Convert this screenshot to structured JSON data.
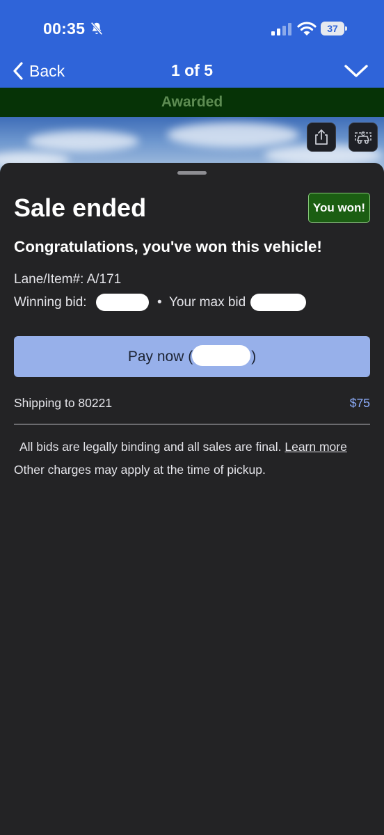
{
  "status_bar": {
    "time": "00:35",
    "battery": "37"
  },
  "navbar": {
    "back_label": "Back",
    "title": "1 of 5"
  },
  "banner": {
    "label": "Awarded"
  },
  "sheet": {
    "title": "Sale ended",
    "badge": "You won!",
    "congrats": "Congratulations, you've won this vehicle!",
    "lane_item": "Lane/Item#: A/171",
    "winning_bid_label": "Winning bid:",
    "separator": "•",
    "max_bid_label": "Your max bid",
    "pay_label_prefix": "Pay now (",
    "pay_label_suffix": ")",
    "shipping_label": "Shipping to 80221",
    "shipping_price": "$75",
    "legal_line1": "All bids are legally binding and all sales are final.",
    "learn_more": "Learn more",
    "legal_line2": "Other charges may apply at the time of pickup."
  },
  "icons": [
    "bell-slash-icon",
    "signal-icon",
    "wifi-icon",
    "battery-icon",
    "chevron-left-icon",
    "chevron-down-icon",
    "share-icon",
    "vehicle-report-icon"
  ],
  "colors": {
    "nav_blue": "#2f64d9",
    "awarded_bg": "#063306",
    "badge_green": "#1b5e12",
    "pay_button": "#97b0ea",
    "price_blue": "#8fb0ff"
  }
}
